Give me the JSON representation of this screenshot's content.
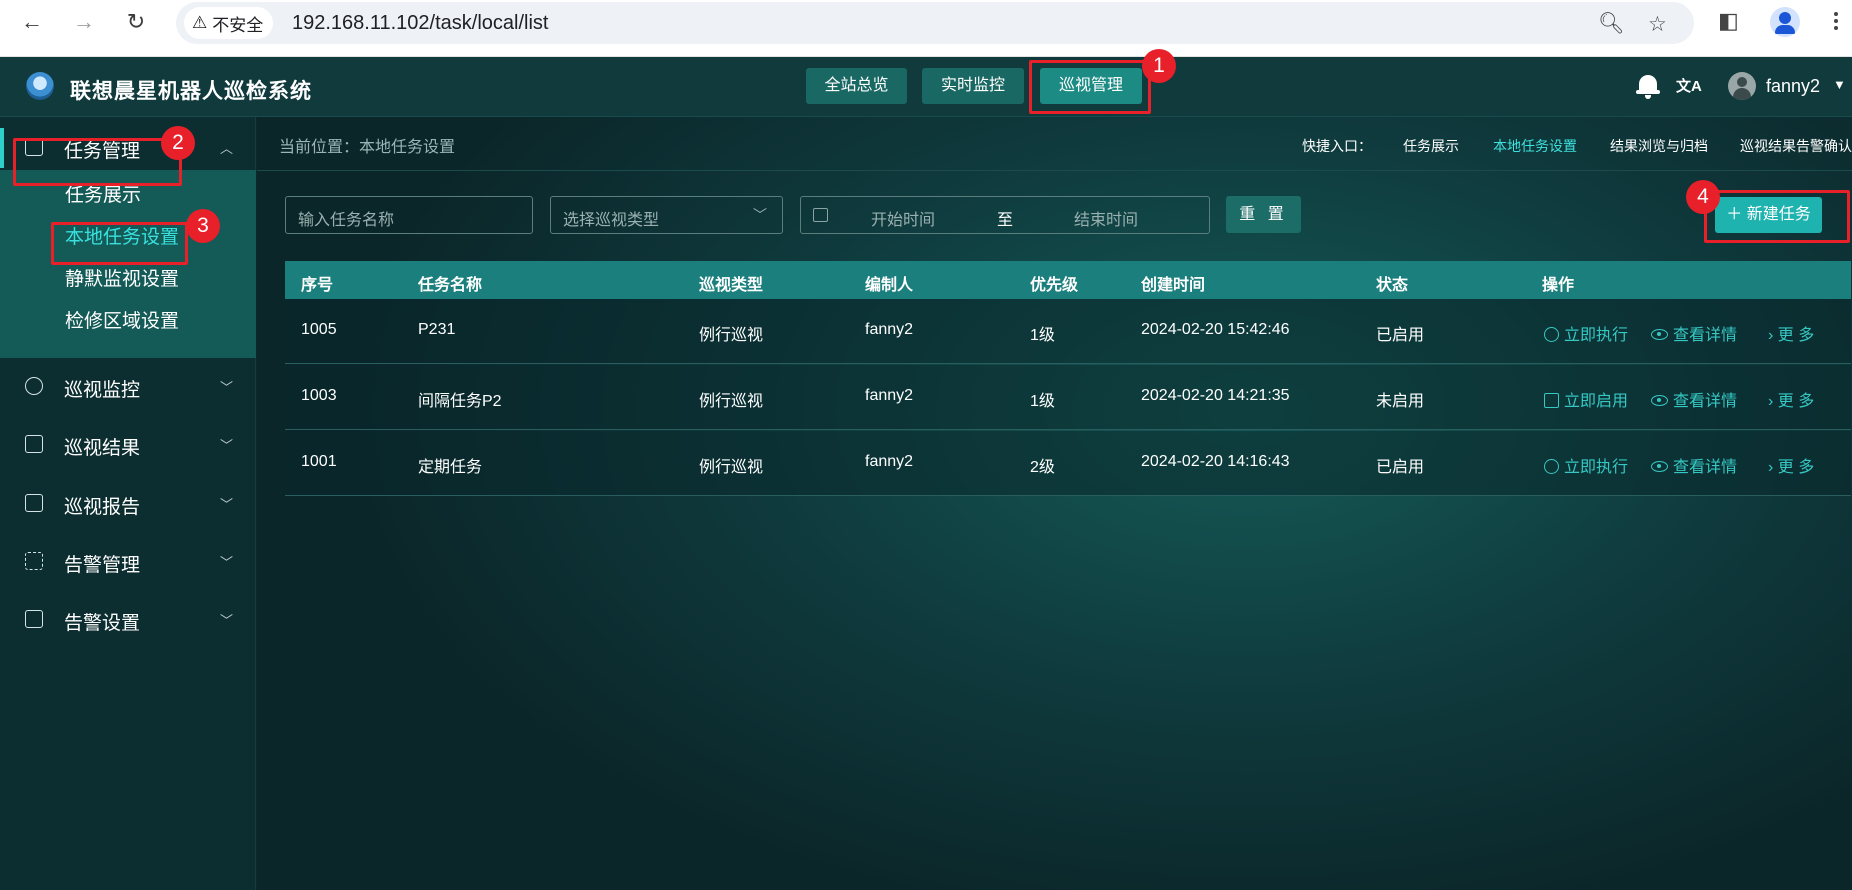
{
  "browser": {
    "insecure_label": "不安全",
    "url": "192.168.11.102/task/local/list"
  },
  "app": {
    "title": "联想晨星机器人巡检系统",
    "top_tabs": [
      "全站总览",
      "实时监控",
      "巡视管理"
    ],
    "active_tab": "巡视管理",
    "translate_glyph": "文A",
    "user": "fanny2"
  },
  "sidebar": {
    "task_group": {
      "label": "任务管理",
      "children": [
        "任务展示",
        "本地任务设置",
        "静默监视设置",
        "检修区域设置"
      ],
      "active_child": "本地任务设置"
    },
    "items": [
      "巡视监控",
      "巡视结果",
      "巡视报告",
      "告警管理",
      "告警设置"
    ]
  },
  "content": {
    "breadcrumb": "当前位置：本地任务设置",
    "quick_label": "快捷入口：",
    "quick_links": [
      "任务展示",
      "本地任务设置",
      "结果浏览与归档",
      "巡视结果告警确认"
    ],
    "filters": {
      "name_placeholder": "输入任务名称",
      "type_placeholder": "选择巡视类型",
      "start_placeholder": "开始时间",
      "range_sep": "至",
      "end_placeholder": "结束时间",
      "reset": "重 置",
      "new_task": "＋ 新建任务"
    },
    "table": {
      "headers": [
        "序号",
        "任务名称",
        "巡视类型",
        "编制人",
        "优先级",
        "创建时间",
        "状态",
        "操作"
      ],
      "rows": [
        {
          "id": "1005",
          "name": "P231",
          "type": "例行巡视",
          "author": "fanny2",
          "priority": "1级",
          "created": "2024-02-20 15:42:46",
          "status": "已启用",
          "action1": "立即执行",
          "action2": "查看详情",
          "action3": "更 多"
        },
        {
          "id": "1003",
          "name": "间隔任务P2",
          "type": "例行巡视",
          "author": "fanny2",
          "priority": "1级",
          "created": "2024-02-20 14:21:35",
          "status": "未启用",
          "action1": "立即启用",
          "action2": "查看详情",
          "action3": "更 多"
        },
        {
          "id": "1001",
          "name": "定期任务",
          "type": "例行巡视",
          "author": "fanny2",
          "priority": "2级",
          "created": "2024-02-20 14:16:43",
          "status": "已启用",
          "action1": "立即执行",
          "action2": "查看详情",
          "action3": "更 多"
        }
      ]
    }
  },
  "annotations": [
    "1",
    "2",
    "3",
    "4"
  ],
  "colors": {
    "accent": "#1fb3b0",
    "active_text": "#39e1de",
    "annotation_red": "#e8202a",
    "header_bg": "#113a3d"
  }
}
